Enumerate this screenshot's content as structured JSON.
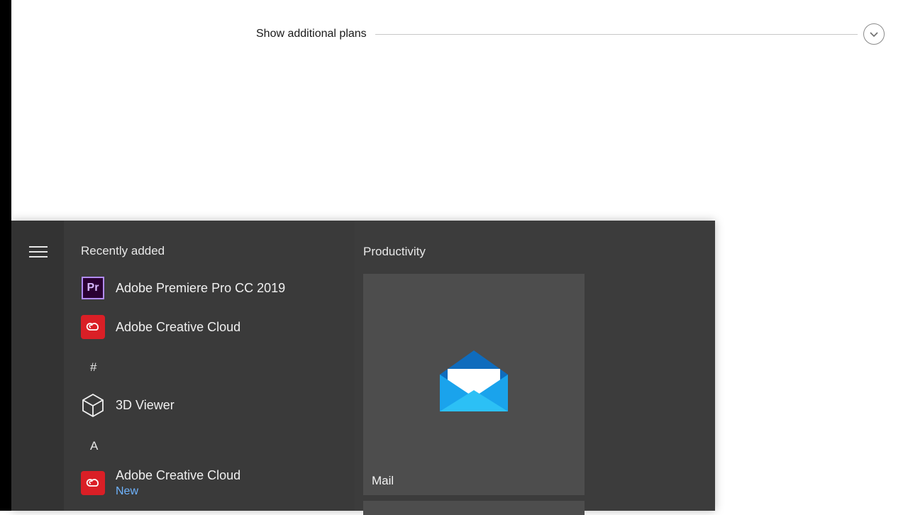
{
  "plans": {
    "label": "Show additional plans"
  },
  "start_menu": {
    "recently_added_title": "Recently added",
    "recent_apps": [
      {
        "name": "Adobe Premiere Pro CC 2019",
        "icon": "premiere-pro-icon",
        "icon_text": "Pr"
      },
      {
        "name": "Adobe Creative Cloud",
        "icon": "creative-cloud-icon"
      }
    ],
    "groups": [
      {
        "letter": "#",
        "apps": [
          {
            "name": "3D Viewer",
            "icon": "cube-icon"
          }
        ]
      },
      {
        "letter": "A",
        "apps": [
          {
            "name": "Adobe Creative Cloud",
            "sub": "New",
            "icon": "creative-cloud-icon"
          }
        ]
      }
    ],
    "tiles": {
      "group_title": "Productivity",
      "mail_label": "Mail"
    }
  },
  "colors": {
    "start_bg": "#3b3b3b",
    "tile_bg": "#4d4d4d",
    "accent_new": "#6fb4ff",
    "cc_red": "#da1f26",
    "premiere_purple": "#2a0033"
  }
}
